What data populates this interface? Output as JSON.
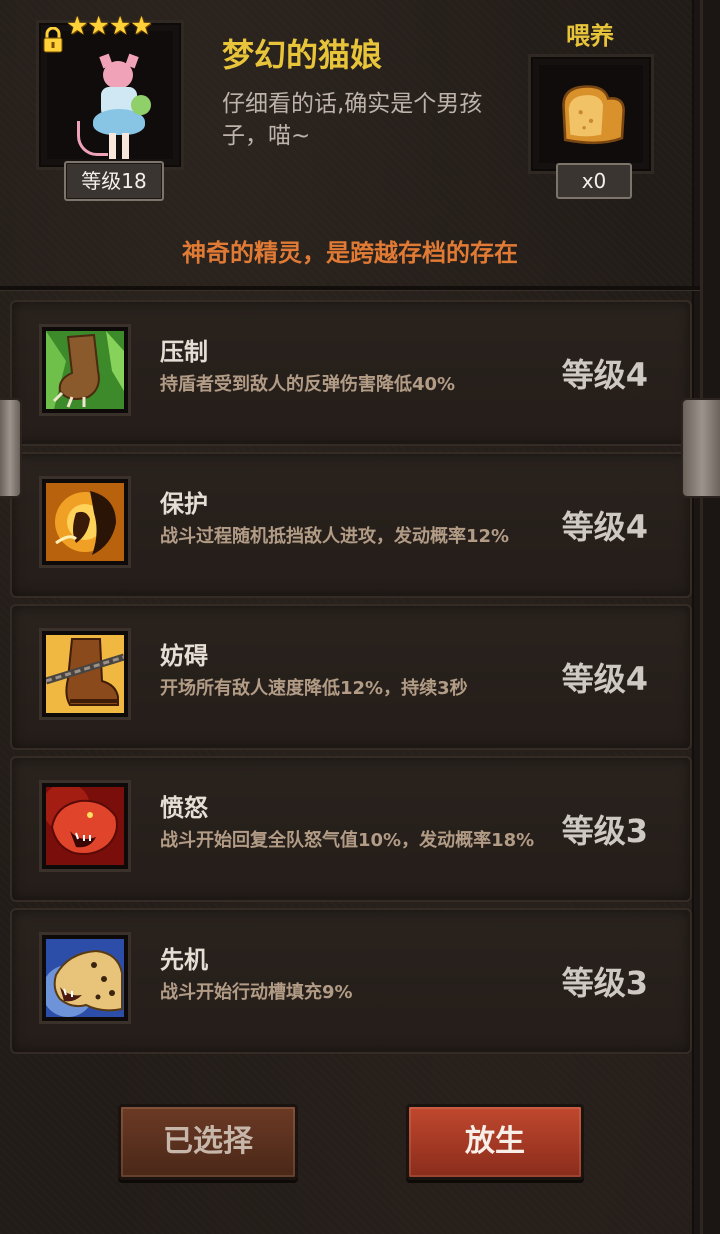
{
  "pet": {
    "name": "梦幻的猫娘",
    "description": "仔细看的话,确实是个男孩子，喵~",
    "stars": "★★★★",
    "level_label": "等级18",
    "locked": true
  },
  "feed": {
    "label": "喂养",
    "count": "x0",
    "item_icon": "bread-icon"
  },
  "tagline": "神奇的精灵，是跨越存档的存在",
  "skills": [
    {
      "name": "压制",
      "description": "持盾者受到敌人的反弹伤害降低40%",
      "level": "等级4",
      "icon": "paw-claw-icon"
    },
    {
      "name": "保护",
      "description": "战斗过程随机抵挡敌人进攻，发动概率12%",
      "level": "等级4",
      "icon": "guardian-spirit-icon"
    },
    {
      "name": "妨碍",
      "description": "开场所有敌人速度降低12%，持续3秒",
      "level": "等级4",
      "icon": "chained-boot-icon"
    },
    {
      "name": "愤怒",
      "description": "战斗开始回复全队怒气值10%，发动概率18%",
      "level": "等级3",
      "icon": "roaring-panther-icon"
    },
    {
      "name": "先机",
      "description": "战斗开始行动槽填充9%",
      "level": "等级3",
      "icon": "leopard-head-icon"
    }
  ],
  "buttons": {
    "selected": "已选择",
    "release": "放生"
  },
  "colors": {
    "title_gold": "#e8c43a",
    "tagline_orange": "#e07a34",
    "release_red": "#c0482e"
  }
}
